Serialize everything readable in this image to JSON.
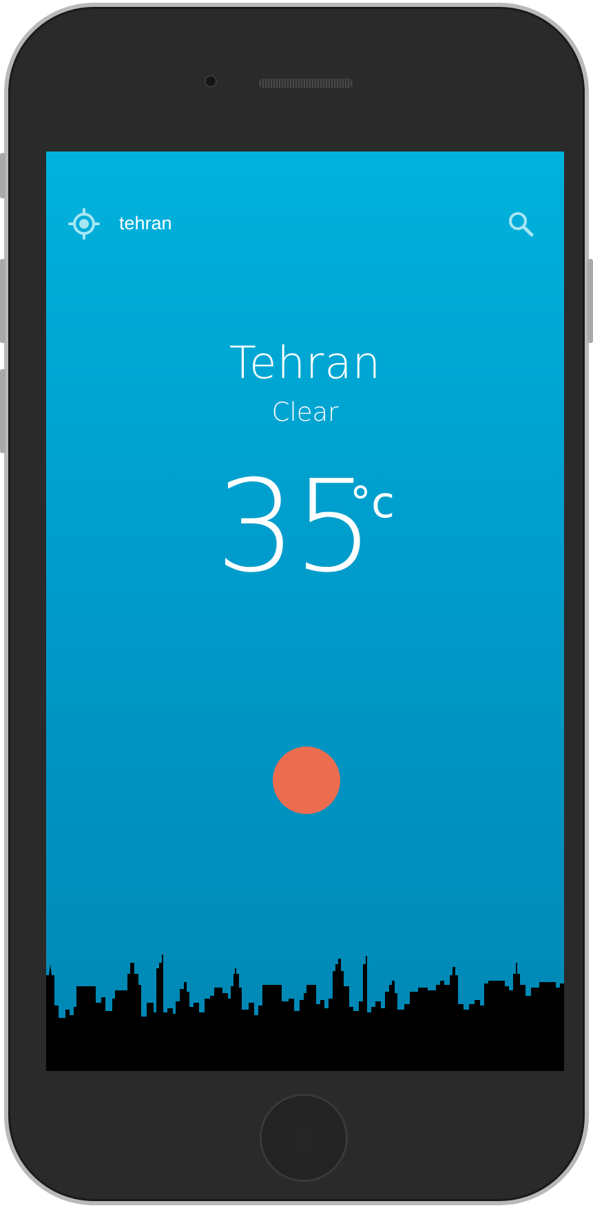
{
  "search": {
    "query": "tehran"
  },
  "weather": {
    "city": "Tehran",
    "condition": "Clear",
    "temperature": "35",
    "unit": "°c"
  },
  "icons": {
    "location": "crosshair-location-icon",
    "search": "search-icon",
    "weather": "sun-icon"
  },
  "colors": {
    "background_top": "#00b2dc",
    "background_bottom": "#0086b3",
    "sun": "#ec6c4f",
    "icon": "#a7e6f4",
    "skyline": "#000000"
  }
}
